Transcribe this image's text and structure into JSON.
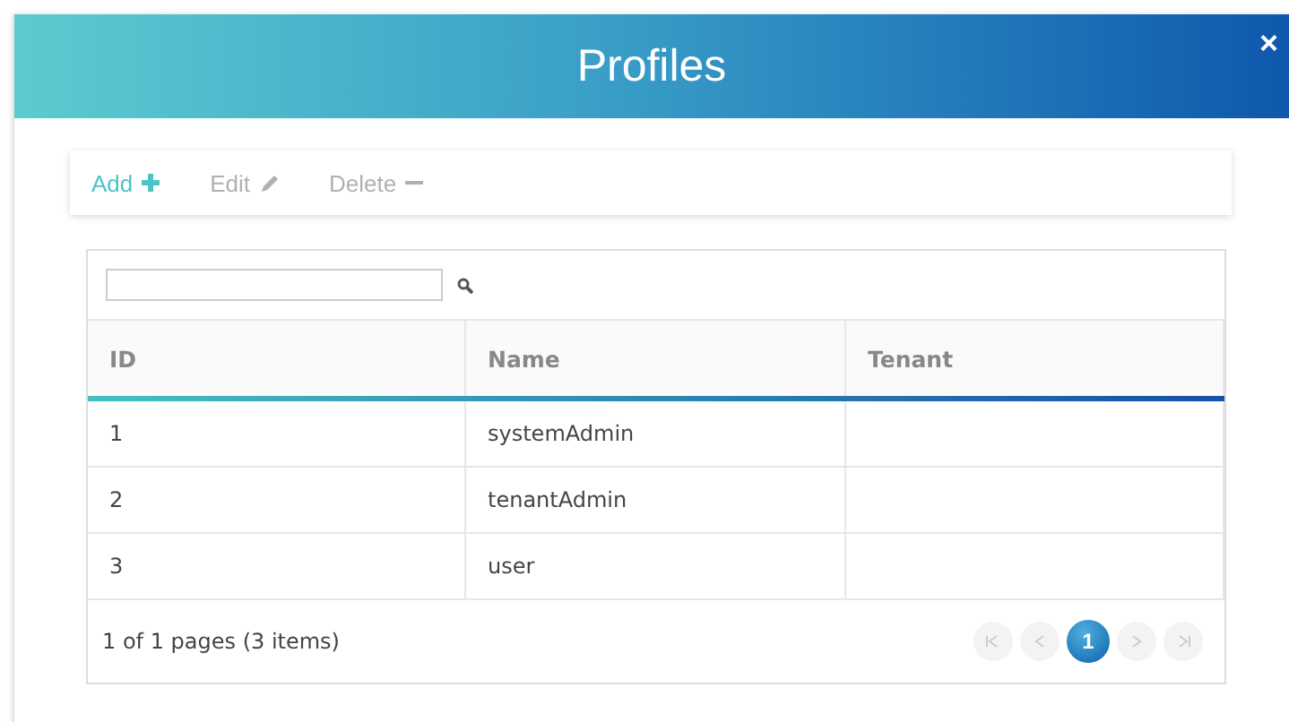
{
  "window": {
    "title": "Profiles",
    "close": "×"
  },
  "toolbar": [
    {
      "label": "Add",
      "kind": "add",
      "disabled": false
    },
    {
      "label": "Edit",
      "kind": "edit",
      "disabled": true
    },
    {
      "label": "Delete",
      "kind": "delete",
      "disabled": true
    }
  ],
  "grid": {
    "columns": [
      "ID",
      "Name",
      "Tenant"
    ],
    "rows": [
      [
        "1",
        "systemAdmin"
      ],
      [
        "2",
        "tenantAdmin"
      ],
      [
        "3",
        "user"
      ]
    ],
    "pager": {
      "info": "1 of 1 pages (3 items)",
      "pages": [
        {
          "label": "1",
          "selected": true
        }
      ]
    }
  }
}
